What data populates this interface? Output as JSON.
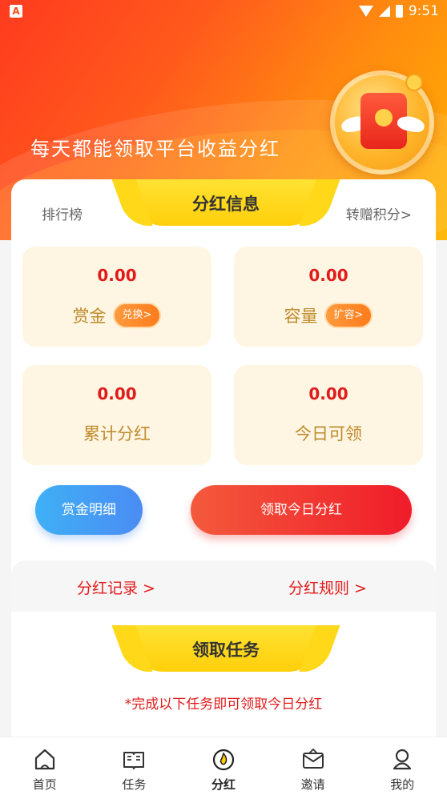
{
  "status_bar": {
    "time": "9:51"
  },
  "hero": {
    "title": "每天都能领取平台收益分红"
  },
  "dividend": {
    "tab_title": "分红信息",
    "ranking_link": "排行榜",
    "transfer_link": "转赠积分>",
    "cards": [
      {
        "value": "0.00",
        "label": "赏金",
        "action": "兑换>"
      },
      {
        "value": "0.00",
        "label": "容量",
        "action": "扩容>"
      },
      {
        "value": "0.00",
        "label": "累计分红"
      },
      {
        "value": "0.00",
        "label": "今日可领"
      }
    ],
    "detail_button": "赏金明细",
    "claim_button": "领取今日分红",
    "records_link": "分红记录  >",
    "rules_link": "分红规则  >"
  },
  "tasks": {
    "title": "领取任务",
    "note": "*完成以下任务即可领取今日分红"
  },
  "nav": [
    {
      "label": "首页",
      "icon": "home-icon"
    },
    {
      "label": "任务",
      "icon": "book-icon"
    },
    {
      "label": "分红",
      "icon": "flame-icon",
      "active": true
    },
    {
      "label": "邀请",
      "icon": "envelope-icon"
    },
    {
      "label": "我的",
      "icon": "user-icon"
    }
  ],
  "colors": {
    "accent_red": "#e11b1b",
    "hero_gradient": [
      "#ff3b1f",
      "#ffb300"
    ],
    "card_bg": "#fef6e3",
    "label_gold": "#c08a2b",
    "banner_yellow": "#ffd81a"
  }
}
